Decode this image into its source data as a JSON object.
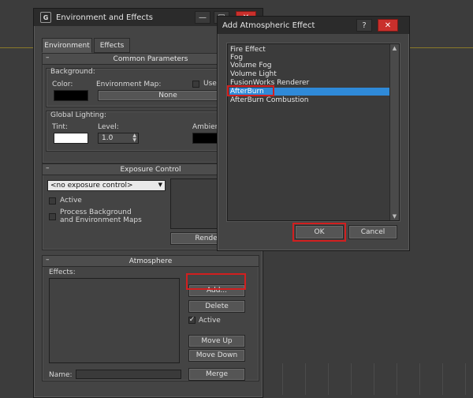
{
  "env_window": {
    "title": "Environment and Effects",
    "icon_glyph": "G",
    "minimize_glyph": "—",
    "maximize_glyph": "□",
    "close_glyph": "✕",
    "tabs": [
      {
        "label": "Environment"
      },
      {
        "label": "Effects"
      }
    ],
    "common_params": {
      "header": "Common Parameters",
      "collapse": "–",
      "background_label": "Background:",
      "color_label": "Color:",
      "env_map_label": "Environment Map:",
      "use_map_label": "Use",
      "env_map_value": "None",
      "global_lighting_label": "Global Lighting:",
      "tint_label": "Tint:",
      "level_label": "Level:",
      "level_value": "1.0",
      "ambient_label": "Ambient",
      "colors": {
        "background": "#000000",
        "tint": "#ffffff",
        "ambient": "#000000"
      }
    },
    "exposure": {
      "header": "Exposure Control",
      "collapse": "–",
      "dropdown_value": "<no exposure control>",
      "active_label": "Active",
      "process_bg_label_1": "Process Background",
      "process_bg_label_2": "and Environment Maps",
      "render_preview_label": "Render Pre"
    },
    "atmosphere": {
      "header": "Atmosphere",
      "collapse": "–",
      "effects_label": "Effects:",
      "add_label": "Add...",
      "delete_label": "Delete",
      "active_label": "Active",
      "active_check": "✓",
      "move_up_label": "Move Up",
      "move_down_label": "Move Down",
      "name_label": "Name:",
      "merge_label": "Merge"
    }
  },
  "dialog": {
    "title": "Add Atmospheric Effect",
    "help_glyph": "?",
    "close_glyph": "✕",
    "items": [
      {
        "label": "Fire Effect"
      },
      {
        "label": "Fog"
      },
      {
        "label": "Volume Fog"
      },
      {
        "label": "Volume Light"
      },
      {
        "label": "FusionWorks Renderer"
      },
      {
        "label": "AfterBurn"
      },
      {
        "label": "AfterBurn Combustion"
      }
    ],
    "selected_item": "AfterBurn",
    "ok_label": "OK",
    "cancel_label": "Cancel",
    "scroll_up_glyph": "▲",
    "scroll_down_glyph": "▼",
    "selection_color": "#2f8ad8",
    "highlight_color": "#d21f1f"
  }
}
